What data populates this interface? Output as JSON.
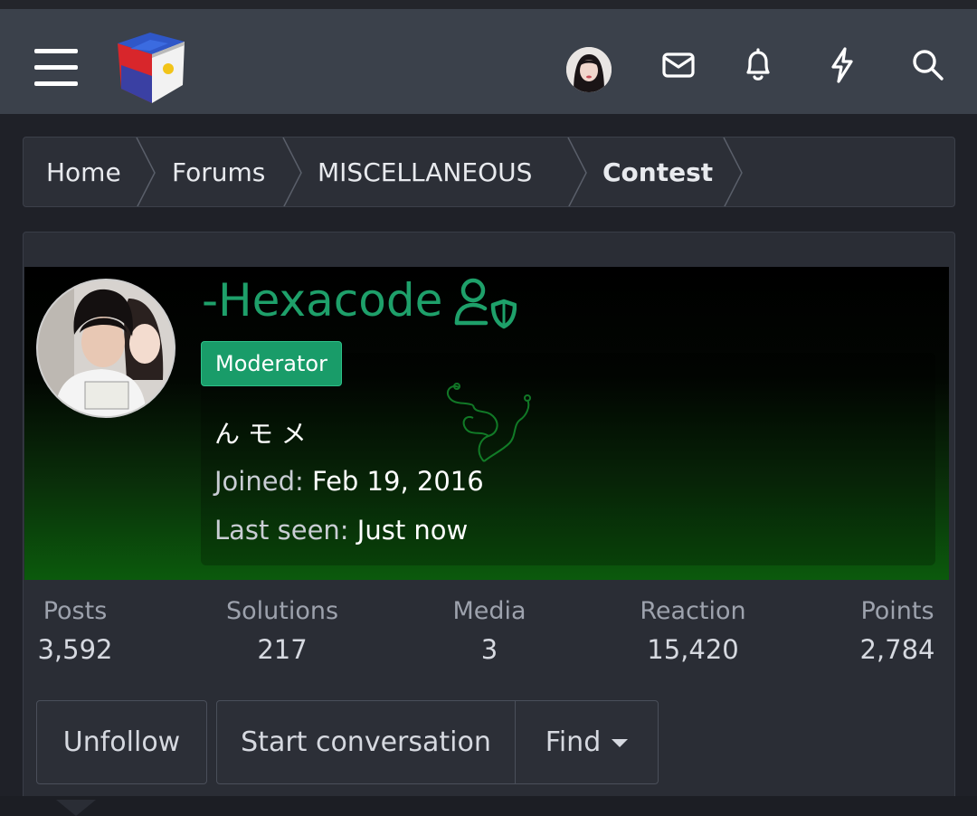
{
  "header": {
    "menu_icon": "hamburger-icon",
    "logo_icon": "philippine-cube-logo",
    "icons": [
      "avatar",
      "envelope-icon",
      "bell-icon",
      "lightning-icon",
      "search-icon"
    ]
  },
  "breadcrumb": {
    "items": [
      {
        "label": "Home"
      },
      {
        "label": "Forums"
      },
      {
        "label": "MISCELLANEOUS"
      },
      {
        "label": "Contest"
      }
    ]
  },
  "profile": {
    "username": "-Hexacode",
    "role_badge": "Moderator",
    "custom_title": "ん モ メ",
    "joined_label": "Joined:",
    "joined_value": "Feb 19, 2016",
    "last_seen_label": "Last seen:",
    "last_seen_value": "Just now",
    "username_color": "#1ea06a",
    "badge_color": "#199c69"
  },
  "stats": [
    {
      "label": "Posts",
      "value": "3,592"
    },
    {
      "label": "Solutions",
      "value": "217"
    },
    {
      "label": "Media",
      "value": "3"
    },
    {
      "label": "Reaction",
      "value": "15,420"
    },
    {
      "label": "Points",
      "value": "2,784"
    }
  ],
  "actions": {
    "unfollow": "Unfollow",
    "start_conversation": "Start conversation",
    "find": "Find"
  }
}
